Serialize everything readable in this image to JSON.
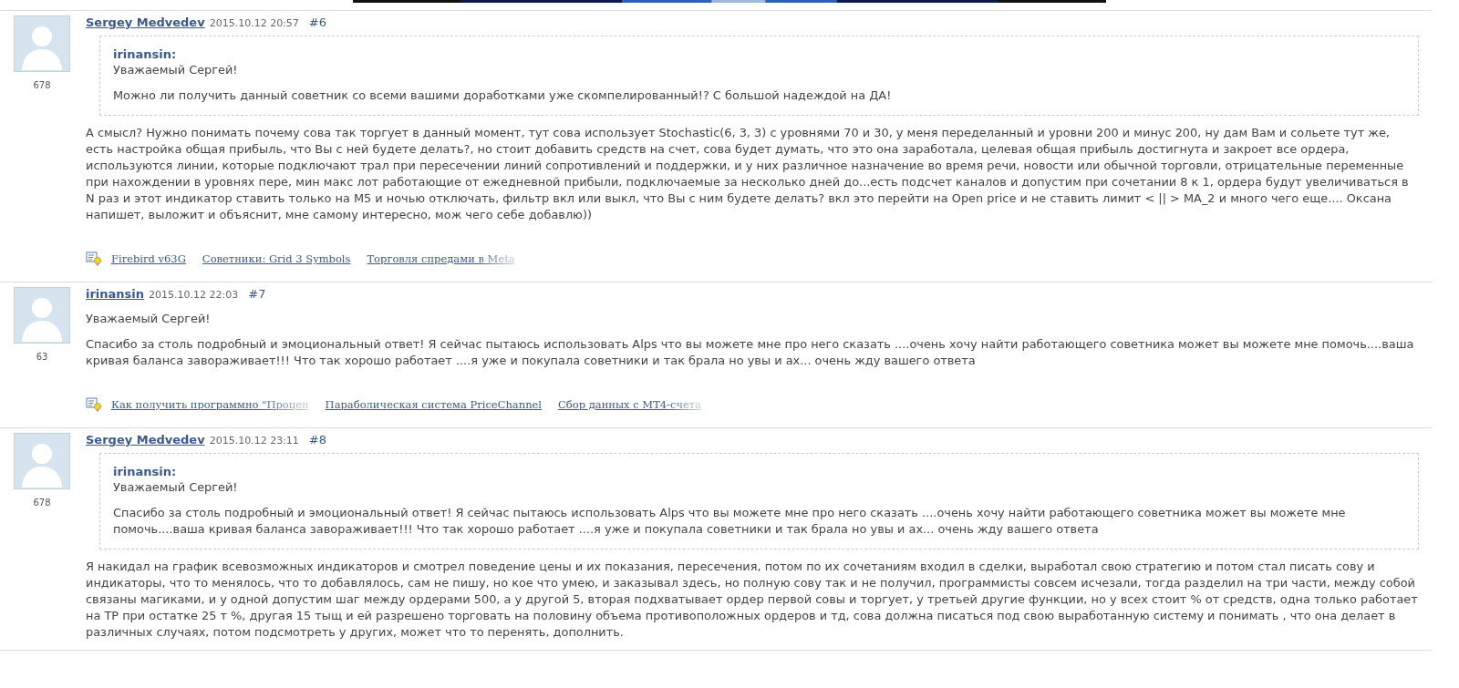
{
  "posts": [
    {
      "author": "Sergey Medvedev",
      "date": "2015.10.12 20:57",
      "number": "#6",
      "rating": "678",
      "quote": {
        "author": "irinansin:",
        "paragraphs": [
          "Уважаемый Сергей!",
          "Можно ли получить данный советник со всеми вашими доработками уже скомпелированный!? С большой надеждой на ДА!"
        ]
      },
      "paragraphs": [
        "А смысл? Нужно понимать почему сова так торгует в данный момент, тут сова использует Stochastic(6, 3, 3) с уровнями 70 и 30, у меня переделанный и уровни 200 и минус 200, ну дам Вам и сольете тут же, есть настройка общая прибыль, что Вы с ней будете делать?, но стоит добавить средств на счет, сова будет думать, что это она заработала, целевая общая прибыль достигнута и закроет все ордера, используются линии, которые подключают трал при пересечении линий сопротивлений и поддержки, и у них различное назначение во время речи, новости или обычной торговли, отрицательные переменные при нахождении в уровнях пере, мин макс лот работающие от ежедневной прибыли, подключаемые за несколько дней до...есть подсчет каналов и допустим при сочетании 8 к 1, ордера будут увеличиваться в N раз и этот индикатор ставить только на М5 и ночью отключать, фильтр вкл или выкл, что Вы с ним будете делать? вкл это перейти на Open price и не ставить лимит < || > MA_2 и много чего еще.... Оксана напишет, выложит и объяснит, мне самому интересно, мож чего себе добавлю))"
      ],
      "related": [
        {
          "text": "Firebird v63G",
          "faded": false
        },
        {
          "text": "Советники: Grid 3 Symbols",
          "faded": false
        },
        {
          "text": "Торговля спредами в Meta",
          "faded": true
        }
      ]
    },
    {
      "author": "irinansin",
      "date": "2015.10.12 22:03",
      "number": "#7",
      "rating": "63",
      "paragraphs": [
        "Уважаемый Сергей!",
        "Спасибо за столь подробный и эмоциональный ответ! Я сейчас пытаюсь использовать Alps что вы можете мне про него сказать ....очень хочу найти работающего советника может вы можете мне помочь....ваша кривая баланса завораживает!!! Что так хорошо работает ....я уже и покупала советники и так брала но увы и ах... очень жду вашего ответа"
      ],
      "related": [
        {
          "text": "Как получить программно \"Процен",
          "faded": true
        },
        {
          "text": "Параболическая система PriceChannel",
          "faded": false
        },
        {
          "text": "Сбор данных с МТ4-счета",
          "faded": true
        }
      ]
    },
    {
      "author": "Sergey Medvedev",
      "date": "2015.10.12 23:11",
      "number": "#8",
      "rating": "678",
      "quote": {
        "author": "irinansin:",
        "paragraphs": [
          "Уважаемый Сергей!",
          "Спасибо за столь подробный и эмоциональный ответ! Я сейчас пытаюсь использовать Alps что вы можете мне про него сказать ....очень хочу найти работающего советника может вы можете мне помочь....ваша кривая баланса завораживает!!! Что так хорошо работает ....я уже и покупала советники и так брала но увы и ах... очень жду вашего ответа"
        ]
      },
      "paragraphs": [
        "Я накидал на график всевозможных индикаторов и смотрел поведение цены и их показания, пересечения, потом по их сочетаниям входил в сделки, выработал свою стратегию и потом стал писать сову и индикаторы, что то менялось, что то добавлялось, сам не пишу, но кое что умею, и заказывал здесь, но полную сову так и не получил, программисты совсем исчезали, тогда разделил на три части, между собой связаны магиками, и у одной допустим шаг между ордерами 500, а у другой 5, вторая подхватывает ордер первой совы и торгует, у третьей другие функции, но у всех стоит % от средств, одна только работает на ТР при остатке 25 т %, другая 15 тыщ  и ей разрешено торговать на половину объема противоположных ордеров и тд, сова должна писаться под свою выработанную систему и понимать , что она делает в различных случаях, потом подсмотреть у других, может что то перенять, дополнить."
      ]
    }
  ]
}
